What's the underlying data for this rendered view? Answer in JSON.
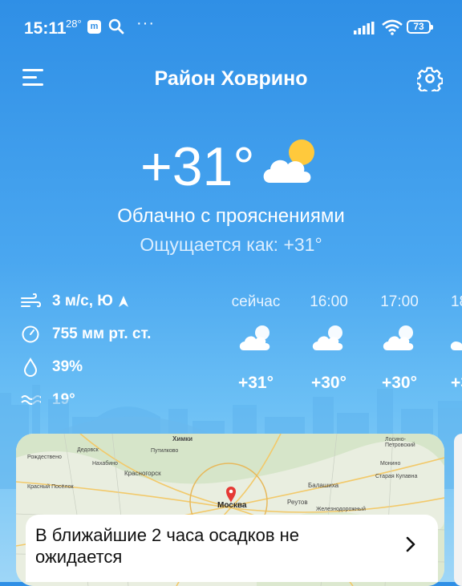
{
  "status_bar": {
    "time": "15:11",
    "temp": "28°",
    "app_badge": "m",
    "dots": "···",
    "battery": "73"
  },
  "header": {
    "title": "Район Ховрино"
  },
  "current": {
    "temperature": "+31°",
    "condition": "Облачно с прояснениями",
    "feels_like": "Ощущается как: +31°",
    "icon": "partly-cloudy-icon"
  },
  "details": {
    "wind": "3 м/с, Ю",
    "pressure": "755 мм рт. ст.",
    "humidity": "39%",
    "water_temp": "19°"
  },
  "hourly": [
    {
      "time": "сейчас",
      "temp": "+31°",
      "icon": "partly-cloudy-icon"
    },
    {
      "time": "16:00",
      "temp": "+30°",
      "icon": "partly-cloudy-icon"
    },
    {
      "time": "17:00",
      "temp": "+30°",
      "icon": "partly-cloudy-icon"
    },
    {
      "time": "18",
      "temp": "+3",
      "icon": "partly-cloudy-icon"
    }
  ],
  "map": {
    "labels": [
      "Химки",
      "Дедовск",
      "Путилково",
      "Рождествено",
      "Нахабино",
      "Красногорск",
      "Красный Посёлок",
      "Москва",
      "Реутов",
      "Балашиха",
      "Старая Купавна",
      "Монино",
      "Лосино-Петровский",
      "Железнодорожный"
    ]
  },
  "precipitation": {
    "text": "В ближайшие 2 часа осадков не ожидается"
  },
  "colors": {
    "sky_top": "#2f8fe6",
    "sky_bottom": "#9ed6f7",
    "sun": "#ffc93c"
  }
}
